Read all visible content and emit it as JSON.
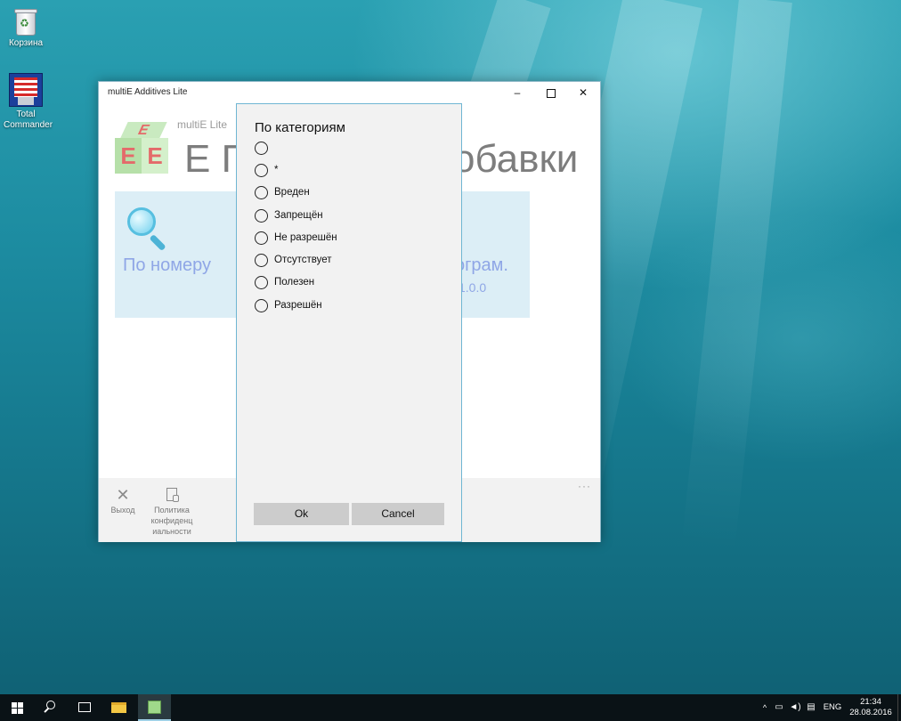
{
  "desktop": {
    "icons": [
      {
        "label": "Корзина",
        "icon": "recycle-bin-icon"
      },
      {
        "label": "Total Commander",
        "icon": "total-commander-icon"
      }
    ]
  },
  "window": {
    "title": "multiE Additives Lite",
    "controls": {
      "minimize": "–",
      "maximize": "□",
      "close": "✕"
    },
    "header": {
      "subtitle": "multiE Lite",
      "title_left": "Е П",
      "title_right": "обавки"
    },
    "tile": {
      "left_label": "По номеру",
      "right_label": "ограм.",
      "version": "1.0.0"
    },
    "commandbar": {
      "exit_label": "Выход",
      "privacy_label": "Политика конфиденц иальности",
      "more": "···"
    }
  },
  "dialog": {
    "title": "По категориям",
    "options": [
      "",
      "*",
      "Вреден",
      "Запрещён",
      "Не разрешён",
      "Отсутствует",
      "Полезен",
      "Разрешён"
    ],
    "ok_label": "Ok",
    "cancel_label": "Cancel"
  },
  "taskbar": {
    "lang": "ENG",
    "time": "21:34",
    "date": "28.08.2016",
    "tray_up": "^"
  }
}
